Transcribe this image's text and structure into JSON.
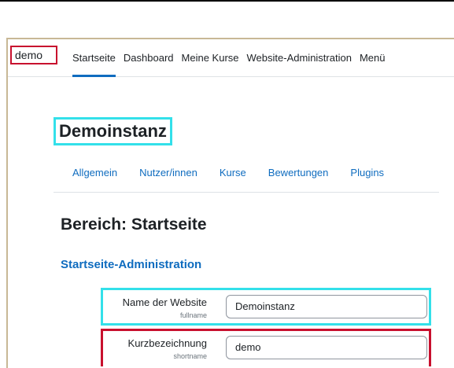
{
  "navbar": {
    "brand": "demo",
    "items": [
      {
        "label": "Startseite"
      },
      {
        "label": "Dashboard"
      },
      {
        "label": "Meine Kurse"
      },
      {
        "label": "Website-Administration"
      },
      {
        "label": "Menü"
      }
    ]
  },
  "page": {
    "site_title": "Demoinstanz",
    "tabs": [
      "Allgemein",
      "Nutzer/innen",
      "Kurse",
      "Bewertungen",
      "Plugins"
    ],
    "section_heading": "Bereich: Startseite",
    "sub_heading": "Startseite-Administration"
  },
  "form": {
    "fields": [
      {
        "label": "Name der Website",
        "setting": "fullname",
        "value": "Demoinstanz"
      },
      {
        "label": "Kurzbezeichnung",
        "setting": "shortname",
        "value": "demo"
      }
    ]
  },
  "colors": {
    "accent": "#0f6cbf",
    "highlight_cyan": "#33e0ea",
    "highlight_red": "#c8102e"
  }
}
